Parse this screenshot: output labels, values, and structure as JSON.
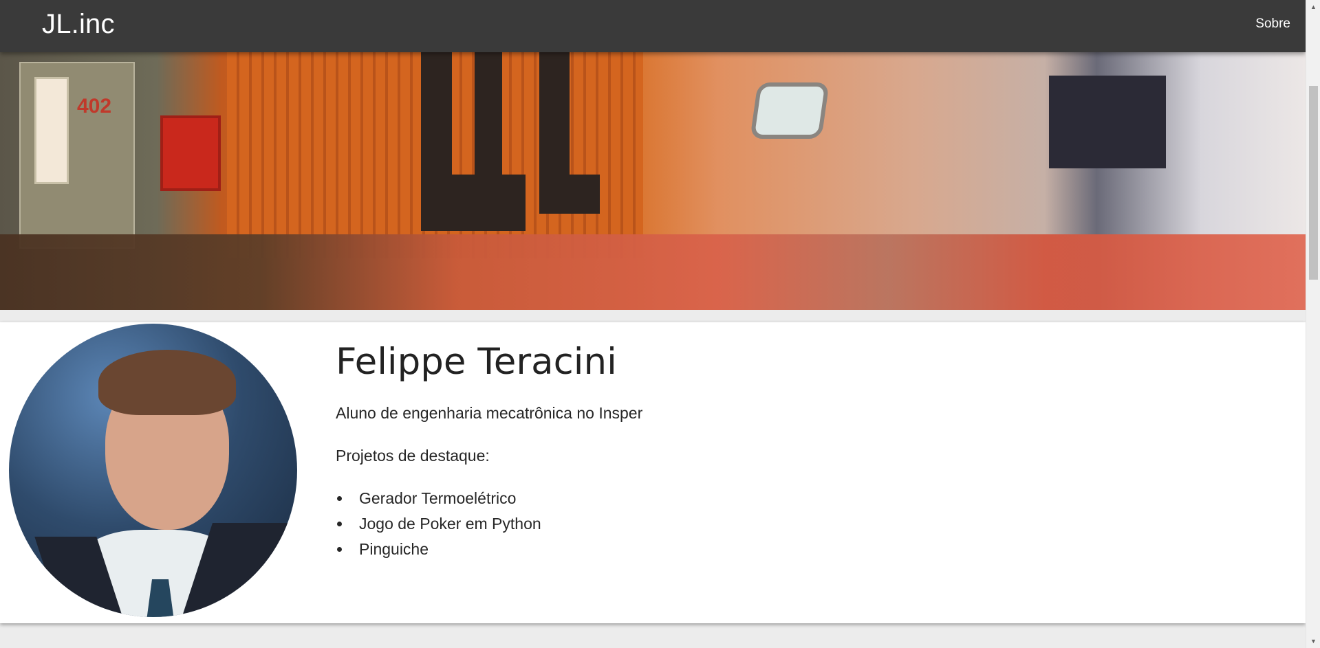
{
  "header": {
    "brand": "JL.inc",
    "nav": [
      {
        "label": "Sobre"
      }
    ]
  },
  "hero": {
    "door_number": "402"
  },
  "profile": {
    "name": "Felippe Teracini",
    "subtitle": "Aluno de engenharia mecatrônica no Insper",
    "projects_title": "Projetos de destaque:",
    "projects": [
      {
        "label": "Gerador Termoelétrico"
      },
      {
        "label": "Jogo de Poker em Python"
      },
      {
        "label": "Pinguiche"
      }
    ]
  },
  "colors": {
    "header_bg": "#3a3a3a",
    "page_bg": "#ececec",
    "card_bg": "#ffffff",
    "text": "#262626"
  }
}
